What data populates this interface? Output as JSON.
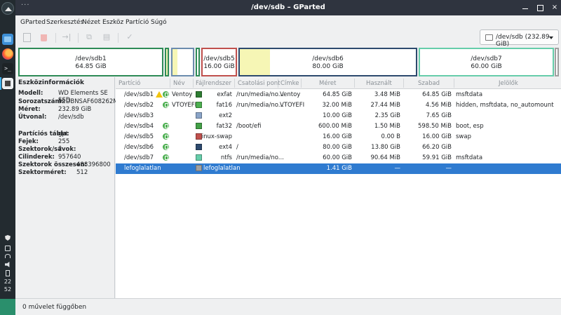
{
  "window": {
    "title": "/dev/sdb – GParted",
    "menu_dots": "···",
    "close_glyph": "×"
  },
  "taskbar": {
    "apps": [
      "launcher-icon",
      "file-manager-icon",
      "firefox-icon",
      "terminal-icon",
      "gparted-icon"
    ],
    "terminal_glyph": ">_",
    "clock_hour": "22",
    "clock_minute": "52"
  },
  "menubar": [
    "GParted",
    "Szerkesztés",
    "Nézet",
    "Eszköz",
    "Partíció",
    "Súgó"
  ],
  "toolbar": {
    "device_selector": "/dev/sdb (232.89 GiB)",
    "glyphs": {
      "resize": "→|",
      "copy": "⧉",
      "paste": "▤",
      "undo": "↶",
      "apply": "✓"
    }
  },
  "diskmap": [
    {
      "name": "/dev/sdb1",
      "size": "64.85 GiB",
      "border": "#2e8b57",
      "used_fraction": 0.0
    },
    {
      "name": "",
      "size": "",
      "border": "#2e8b57",
      "used_fraction": 0.85
    },
    {
      "name": "",
      "size": "",
      "border": "#6b8cae",
      "used_fraction": 0.25
    },
    {
      "name": "",
      "size": "",
      "border": "#2e8b57",
      "used_fraction": 0.0
    },
    {
      "name": "/dev/sdb5",
      "size": "16.00 GiB",
      "border": "#c0504d",
      "used_fraction": 0.0
    },
    {
      "name": "/dev/sdb6",
      "size": "80.00 GiB",
      "border": "#2d4a6e",
      "used_fraction": 0.17
    },
    {
      "name": "/dev/sdb7",
      "size": "60.00 GiB",
      "border": "#66cdaa",
      "used_fraction": 0.0
    },
    {
      "name": "",
      "size": "",
      "border": "#a0a0a0",
      "used_fraction": 0.0
    }
  ],
  "device_info": {
    "heading": "Eszközinformációk",
    "rows": [
      {
        "key": "Modell:",
        "value": "WD Elements SE SSD"
      },
      {
        "key": "Sorozatszám:",
        "value": "51DBNSAF608262M"
      },
      {
        "key": "Méret:",
        "value": "232.89 GiB"
      },
      {
        "key": "Útvonal:",
        "value": "/dev/sdb"
      },
      {
        "key": "Partíciós tábla:",
        "value": "gpt"
      },
      {
        "key": "Fejek:",
        "value": "255"
      },
      {
        "key": "Szektorok/sávok:",
        "value": "2"
      },
      {
        "key": "Cilinderek:",
        "value": "957640"
      },
      {
        "key": "Szektorok összesen:",
        "value": "488396800"
      },
      {
        "key": "Szektorméret:",
        "value": "512"
      }
    ]
  },
  "table": {
    "headers": [
      "Partíció",
      "Név",
      "Fájlrendszer",
      "Csatolási pont",
      "Címke",
      "Méret",
      "Használt",
      "Szabad",
      "Jelölők"
    ],
    "rows": [
      {
        "partition": "/dev/sdb1",
        "name": "Ventoy",
        "fs": "exfat",
        "fs_color": "#2e7d32",
        "mount": "/run/media/no...",
        "label": "Ventoy",
        "size": "64.85 GiB",
        "used": "3.48 MiB",
        "free": "64.85 GiB",
        "flags": "msftdata",
        "warn": true,
        "lock": true,
        "selected": false
      },
      {
        "partition": "/dev/sdb2",
        "name": "VTOYEFI",
        "fs": "fat16",
        "fs_color": "#4caf50",
        "mount": "/run/media/no...",
        "label": "VTOYEFI",
        "size": "32.00 MiB",
        "used": "27.44 MiB",
        "free": "4.56 MiB",
        "flags": "hidden, msftdata, no_automount",
        "warn": false,
        "lock": true,
        "selected": false
      },
      {
        "partition": "/dev/sdb3",
        "name": "",
        "fs": "ext2",
        "fs_color": "#8aa4c8",
        "mount": "",
        "label": "",
        "size": "10.00 GiB",
        "used": "2.35 GiB",
        "free": "7.65 GiB",
        "flags": "",
        "warn": false,
        "lock": false,
        "selected": false
      },
      {
        "partition": "/dev/sdb4",
        "name": "",
        "fs": "fat32",
        "fs_color": "#43a047",
        "mount": "/boot/efi",
        "label": "",
        "size": "600.00 MiB",
        "used": "1.50 MiB",
        "free": "598.50 MiB",
        "flags": "boot, esp",
        "warn": false,
        "lock": true,
        "selected": false
      },
      {
        "partition": "/dev/sdb5",
        "name": "",
        "fs": "linux-swap",
        "fs_color": "#c0504d",
        "mount": "",
        "label": "",
        "size": "16.00 GiB",
        "used": "0.00 B",
        "free": "16.00 GiB",
        "flags": "swap",
        "warn": false,
        "lock": true,
        "selected": false
      },
      {
        "partition": "/dev/sdb6",
        "name": "",
        "fs": "ext4",
        "fs_color": "#2d4a6e",
        "mount": "/",
        "label": "",
        "size": "80.00 GiB",
        "used": "13.80 GiB",
        "free": "66.20 GiB",
        "flags": "",
        "warn": false,
        "lock": true,
        "selected": false
      },
      {
        "partition": "/dev/sdb7",
        "name": "",
        "fs": "ntfs",
        "fs_color": "#66cdaa",
        "mount": "/run/media/no...",
        "label": "",
        "size": "60.00 GiB",
        "used": "90.64 MiB",
        "free": "59.91 GiB",
        "flags": "msftdata",
        "warn": false,
        "lock": true,
        "selected": false
      },
      {
        "partition": "lefoglalatlan",
        "name": "",
        "fs": "lefoglalatlan",
        "fs_color": "#a0a0a0",
        "mount": "",
        "label": "",
        "size": "1.41 GiB",
        "used": "—",
        "free": "—",
        "flags": "",
        "warn": false,
        "lock": false,
        "selected": true
      }
    ]
  },
  "statusbar": {
    "text": "0 művelet függőben"
  }
}
